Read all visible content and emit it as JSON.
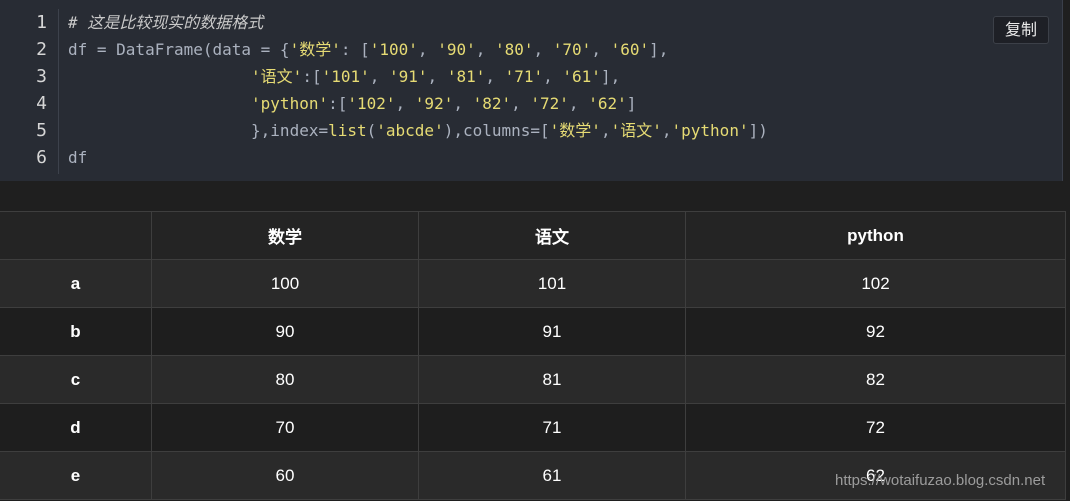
{
  "code": {
    "line_numbers": [
      "1",
      "2",
      "3",
      "4",
      "5",
      "6"
    ],
    "line1_comment": "# 这是比较现实的数据格式",
    "line2_prefix": "df = DataFrame(data = {",
    "line2_key": "'数学'",
    "line2_mid": ": [",
    "line2_vals": [
      "'100'",
      "'90'",
      "'80'",
      "'70'",
      "'60'"
    ],
    "line2_suffix": "],",
    "line3_indent": "                   ",
    "line3_key": "'语文'",
    "line3_mid": ":[",
    "line3_vals": [
      "'101'",
      "'91'",
      "'81'",
      "'71'",
      "'61'"
    ],
    "line3_suffix": "],",
    "line4_key": "'python'",
    "line4_mid": ":[",
    "line4_vals": [
      "'102'",
      "'92'",
      "'82'",
      "'72'",
      "'62'"
    ],
    "line4_suffix": "]",
    "line5_a": "},index=",
    "line5_fn": "list",
    "line5_b": "(",
    "line5_str": "'abcde'",
    "line5_c": "),columns=[",
    "line5_cols": [
      "'数学'",
      "'语文'",
      "'python'"
    ],
    "line5_d": "])",
    "line6": "df"
  },
  "copy_button": {
    "label": "复制"
  },
  "table": {
    "columns": [
      "",
      "数学",
      "语文",
      "python"
    ],
    "rows": [
      {
        "index": "a",
        "values": [
          "100",
          "101",
          "102"
        ]
      },
      {
        "index": "b",
        "values": [
          "90",
          "91",
          "92"
        ]
      },
      {
        "index": "c",
        "values": [
          "80",
          "81",
          "82"
        ]
      },
      {
        "index": "d",
        "values": [
          "70",
          "71",
          "72"
        ]
      },
      {
        "index": "e",
        "values": [
          "60",
          "61",
          "62"
        ]
      }
    ]
  },
  "watermark": "https://wotaifuzao.blog.csdn.net"
}
